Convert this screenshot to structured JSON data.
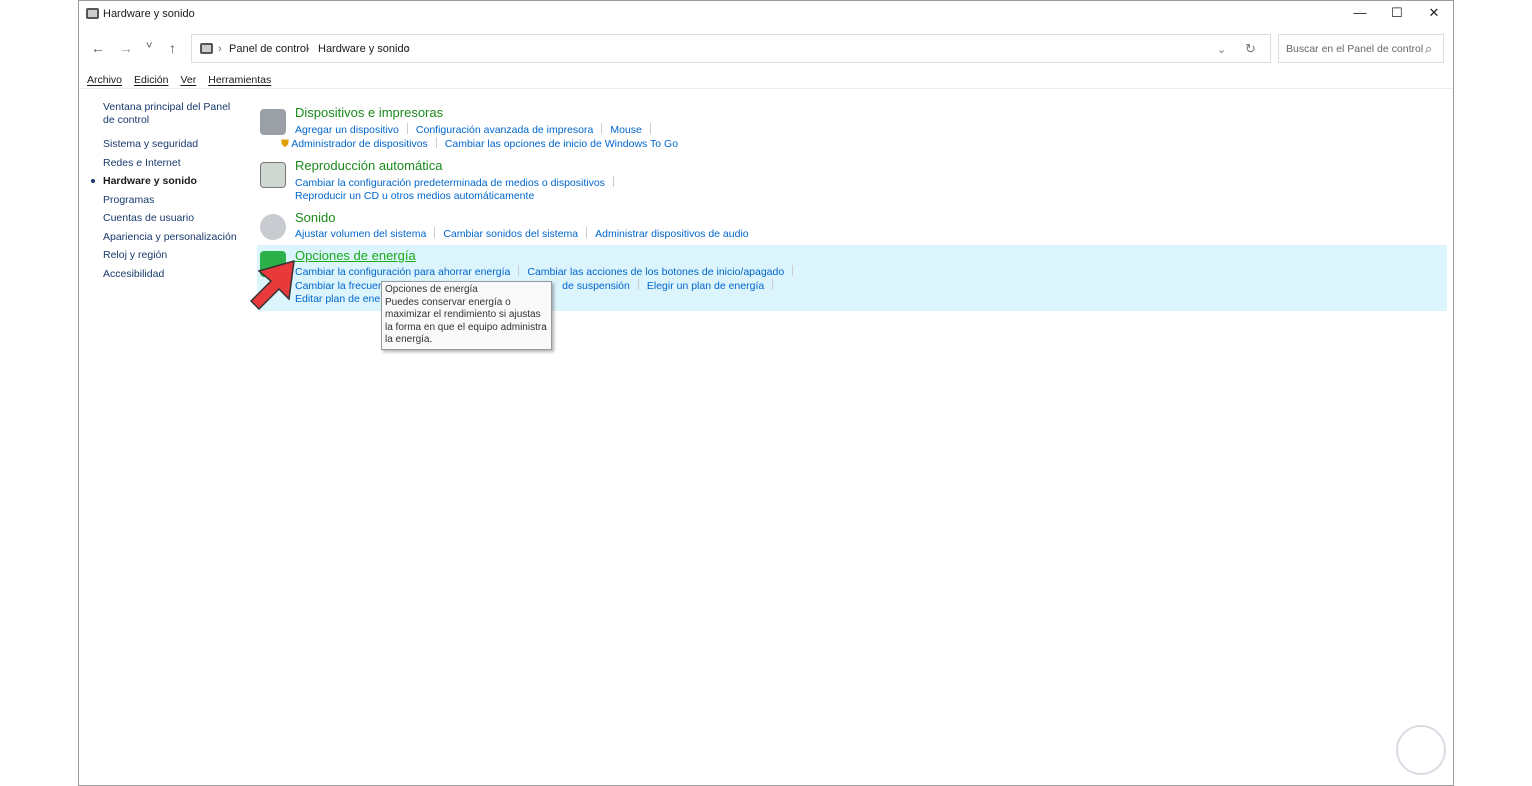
{
  "window": {
    "title": "Hardware y sonido",
    "minimize": "—",
    "maximize": "☐",
    "close": "✕"
  },
  "nav": {
    "back": "←",
    "forward": "→",
    "recent": "˅",
    "up": "↑"
  },
  "address": {
    "crumbs": [
      "Panel de control",
      "Hardware y sonido"
    ],
    "sep": "›",
    "dropdown": "⌄",
    "refresh": "↻"
  },
  "search": {
    "placeholder": "Buscar en el Panel de control",
    "icon": "⌕"
  },
  "menu": [
    "Archivo",
    "Edición",
    "Ver",
    "Herramientas"
  ],
  "sidebar": {
    "items": [
      "Ventana principal del Panel de control",
      "Sistema y seguridad",
      "Redes e Internet",
      "Hardware y sonido",
      "Programas",
      "Cuentas de usuario",
      "Apariencia y personalización",
      "Reloj y región",
      "Accesibilidad"
    ],
    "active": "Hardware y sonido"
  },
  "categories": [
    {
      "title": "Dispositivos e impresoras",
      "lines": [
        [
          "Agregar un dispositivo",
          "Configuración avanzada de impresora",
          "Mouse"
        ],
        [
          "Administrador de dispositivos",
          "Cambiar las opciones de inicio de Windows To Go"
        ]
      ]
    },
    {
      "title": "Reproducción automática",
      "lines": [
        [
          "Cambiar la configuración predeterminada de medios o dispositivos"
        ],
        [
          "Reproducir un CD u otros medios automáticamente"
        ]
      ]
    },
    {
      "title": "Sonido",
      "lines": [
        [
          "Ajustar volumen del sistema",
          "Cambiar sonidos del sistema",
          "Administrar dispositivos de audio"
        ]
      ]
    },
    {
      "title": "Opciones de energía",
      "lines": [
        [
          "Cambiar la configuración para ahorrar energía",
          "Cambiar las acciones de los botones de inicio/apagado"
        ],
        [
          "Cambiar la frecuencia",
          "de suspensión",
          "Elegir un plan de energía"
        ],
        [
          "Editar plan de energ"
        ]
      ]
    }
  ],
  "tooltip": {
    "title": "Opciones de energía",
    "body": "Puedes conservar energía o maximizar el rendimiento si ajustas la forma en que el equipo administra la energía."
  },
  "colors": {
    "link": "#0066cc",
    "category": "#1b8a1b",
    "highlight": "#dcf4fc",
    "arrow": "#e83a3a"
  }
}
